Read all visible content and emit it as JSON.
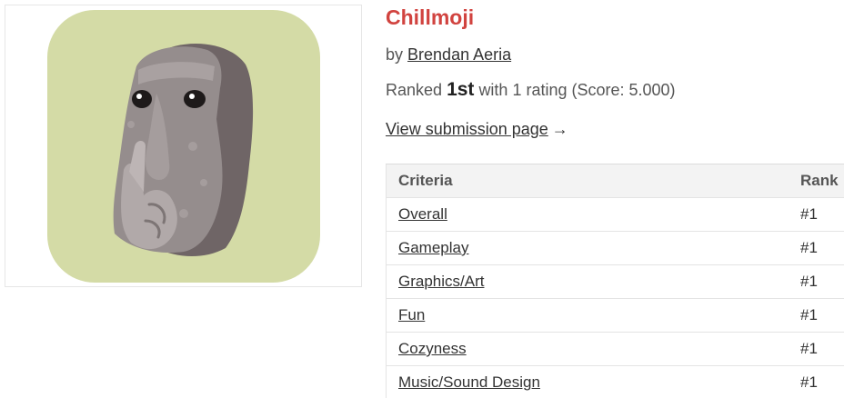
{
  "game": {
    "title": "Chillmoji",
    "by_prefix": "by",
    "author": "Brendan Aeria",
    "ranked_prefix": "Ranked",
    "place": "1st",
    "ranked_suffix": "with 1 rating (Score: 5.000)",
    "view_link": "View submission page",
    "view_arrow": "→"
  },
  "table": {
    "headers": [
      "Criteria",
      "Rank"
    ],
    "rows": [
      {
        "criteria": "Overall",
        "rank": "#1"
      },
      {
        "criteria": "Gameplay",
        "rank": "#1"
      },
      {
        "criteria": "Graphics/Art",
        "rank": "#1"
      },
      {
        "criteria": "Fun",
        "rank": "#1"
      },
      {
        "criteria": "Cozyness",
        "rank": "#1"
      },
      {
        "criteria": "Music/Sound Design",
        "rank": "#1"
      }
    ]
  },
  "colors": {
    "title": "#d1433f",
    "thumb_bg": "#d4dba6",
    "stone": "#8e8686"
  },
  "thumbnail": {
    "icon": "moai-shush-icon"
  }
}
